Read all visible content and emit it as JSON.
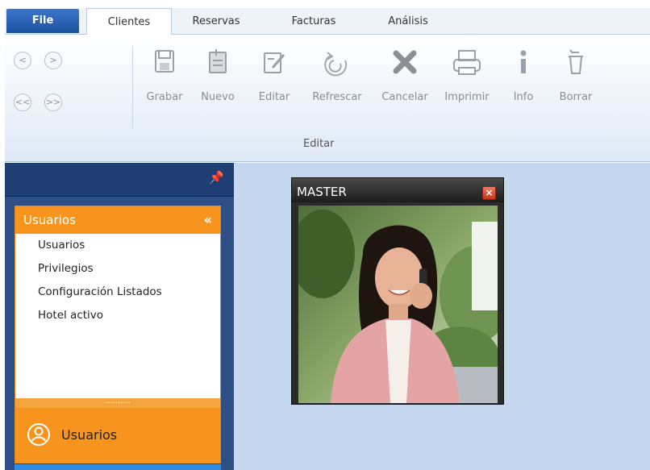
{
  "ribbon": {
    "tabs": [
      {
        "label": "File"
      },
      {
        "label": "Clientes"
      },
      {
        "label": "Reservas"
      },
      {
        "label": "Facturas"
      },
      {
        "label": "Análisis"
      }
    ],
    "nav_buttons": [
      {
        "label": "<"
      },
      {
        "label": ">"
      },
      {
        "label": "<<"
      },
      {
        "label": ">>"
      }
    ],
    "commands": [
      {
        "label": "Grabar",
        "icon": "save-icon"
      },
      {
        "label": "Nuevo",
        "icon": "new-document-icon"
      },
      {
        "label": "Editar",
        "icon": "edit-icon"
      },
      {
        "label": "Refrescar",
        "icon": "refresh-icon"
      },
      {
        "label": "Cancelar",
        "icon": "cancel-icon"
      },
      {
        "label": "Imprimir",
        "icon": "print-icon"
      },
      {
        "label": "Info",
        "icon": "info-icon"
      },
      {
        "label": "Borrar",
        "icon": "trash-icon"
      }
    ],
    "group_label": "Editar"
  },
  "nav_pane": {
    "pin_icon": "pin-icon",
    "section": {
      "title": "Usuarios",
      "collapse_glyph": "«",
      "items": [
        {
          "label": "Usuarios"
        },
        {
          "label": "Privilegios"
        },
        {
          "label": "Configuración Listados"
        },
        {
          "label": "Hotel activo"
        }
      ]
    },
    "splitter_glyph": "..........",
    "group_button": {
      "label": "Usuarios",
      "icon": "user-circle-icon"
    }
  },
  "master_window": {
    "title": "MASTER",
    "close_glyph": "×",
    "image": "woman-on-phone-photo"
  },
  "colors": {
    "file_tab": "#2a63b8",
    "nav_pane": "#2e4f86",
    "accent_orange": "#f6941e",
    "workspace": "#c5d8ef"
  }
}
